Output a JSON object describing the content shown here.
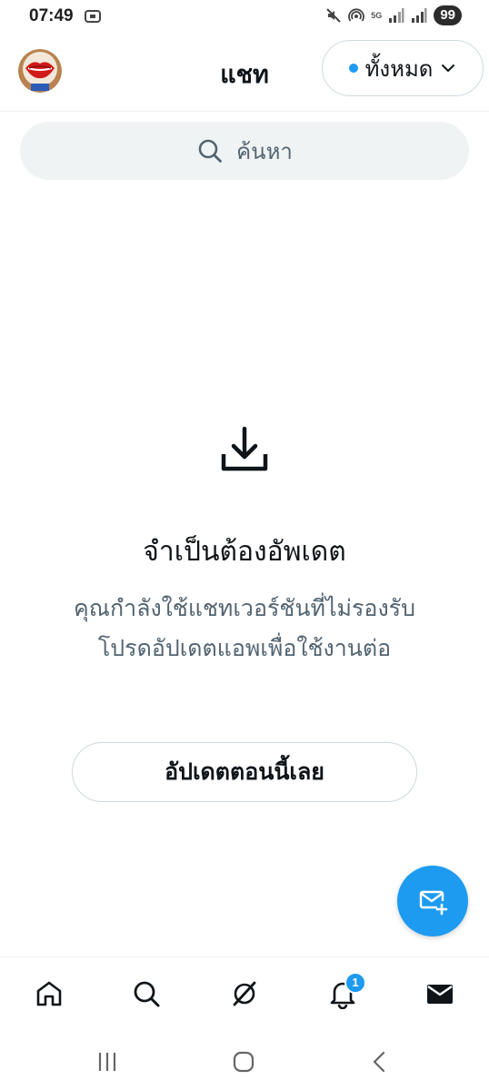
{
  "status_bar": {
    "time": "07:49",
    "network_label": "5G",
    "battery": "99",
    "icons": [
      "screen-record-icon",
      "mute-icon",
      "hotspot-icon",
      "signal-icon",
      "signal-icon"
    ]
  },
  "header": {
    "title": "แชท",
    "filter": {
      "label": "ทั้งหมด",
      "dot_color": "#1d9bf0"
    },
    "avatar_icon": "lips-avatar"
  },
  "search": {
    "placeholder": "ค้นหา"
  },
  "empty_state": {
    "icon": "download-icon",
    "title": "จำเป็นต้องอัพเดต",
    "message": "คุณกำลังใช้แชทเวอร์ชันที่ไม่รองรับ โปรดอัปเดตแอพเพื่อใช้งานต่อ",
    "button_label": "อัปเดตตอนนี้เลย"
  },
  "fab": {
    "icon": "new-message-icon",
    "color": "#1d9bf0"
  },
  "bottom_nav": {
    "items": [
      "home-icon",
      "search-icon",
      "grok-icon",
      "notifications-icon",
      "messages-icon"
    ],
    "notification_count": "1",
    "badge_color": "#1d9bf0"
  },
  "system_nav": {
    "items": [
      "recent-apps-icon",
      "home-circle-icon",
      "back-icon"
    ]
  },
  "colors": {
    "accent": "#1d9bf0",
    "text_primary": "#0f1419",
    "text_secondary": "#536471",
    "border": "#cfd9de",
    "search_bg": "#eff3f4"
  }
}
